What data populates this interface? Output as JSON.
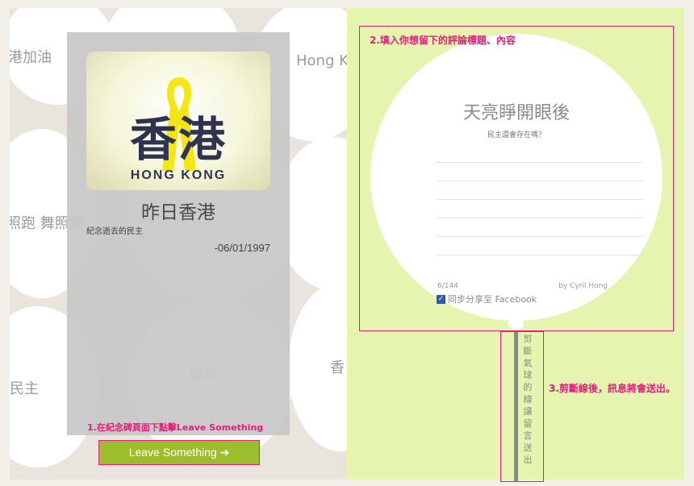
{
  "background_words": [
    "港加油",
    "Hong K",
    "照跑 舞照跳",
    "民主",
    "如果",
    "香",
    "港",
    "香"
  ],
  "memorial": {
    "logo_cn": "香港",
    "logo_en": "HONG KONG",
    "title": "昨日香港",
    "subtitle": "紀念逝去的民主",
    "date": "-06/01/1997",
    "leave_button": "Leave Something ➜"
  },
  "annotations": {
    "step1": "1.在紀念碑頁面下點擊Leave Something",
    "step2": "2.填入你想留下的評論標題、內容",
    "step3": "3.剪斷線後，訊息將會送出。"
  },
  "balloon": {
    "title": "天亮睜開眼後",
    "prompt": "民主還會存在嗎？",
    "counter": "6/144",
    "byline": "by Cyril Hong",
    "share_label": "同步分享至 Facebook",
    "share_checked": true
  },
  "string_text": "剪斷氣球的線讓留言送出",
  "colors": {
    "accent": "#e0207a",
    "button_green": "#9cbd2c",
    "right_bg": "#e5f4ae"
  }
}
